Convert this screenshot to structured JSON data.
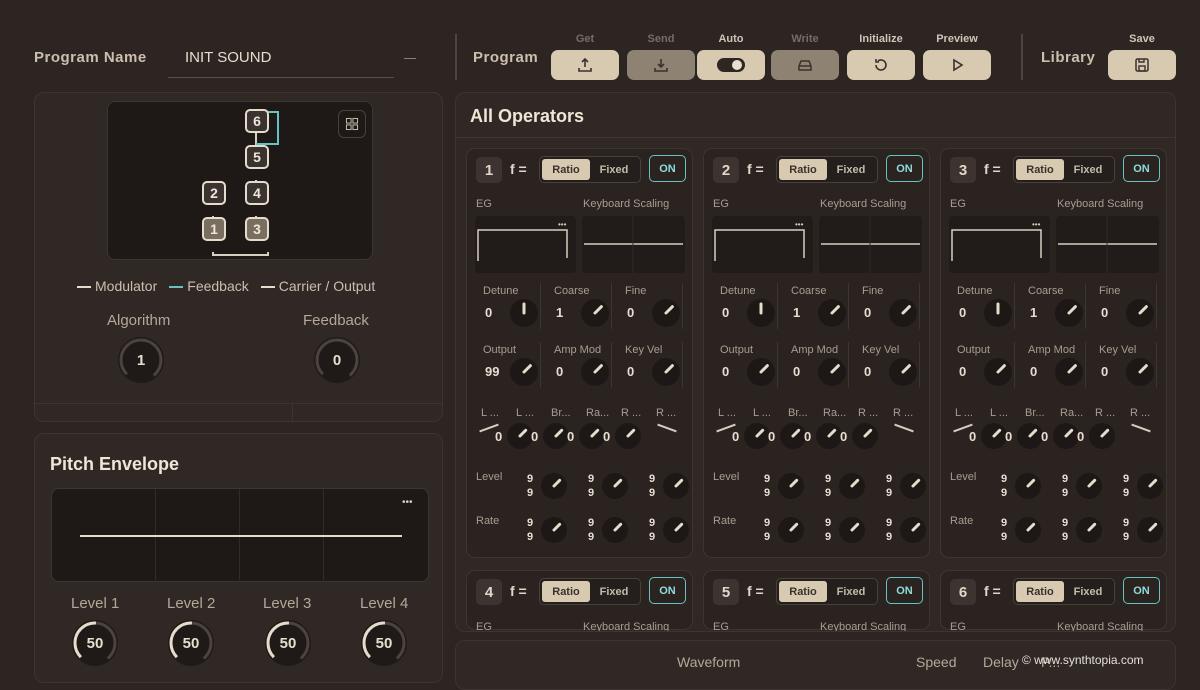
{
  "header": {
    "program_name_label": "Program Name",
    "program_name_value": "INIT SOUND",
    "program_label": "Program",
    "library_label": "Library",
    "buttons": {
      "get": "Get",
      "send": "Send",
      "auto": "Auto",
      "write": "Write",
      "initialize": "Initialize",
      "preview": "Preview",
      "save": "Save"
    }
  },
  "algorithm": {
    "legend_modulator": "Modulator",
    "legend_feedback": "Feedback",
    "legend_carrier": "Carrier / Output",
    "algorithm_label": "Algorithm",
    "algorithm_value": "1",
    "feedback_label": "Feedback",
    "feedback_value": "0",
    "nodes": [
      "6",
      "5",
      "4",
      "3",
      "2",
      "1"
    ]
  },
  "pitch_envelope": {
    "title": "Pitch Envelope",
    "more": "•••",
    "levels": [
      {
        "label": "Level 1",
        "value": "50"
      },
      {
        "label": "Level 2",
        "value": "50"
      },
      {
        "label": "Level 3",
        "value": "50"
      },
      {
        "label": "Level 4",
        "value": "50"
      }
    ]
  },
  "operators_section": {
    "title": "All Operators",
    "f_label": "f =",
    "ratio": "Ratio",
    "fixed": "Fixed",
    "on": "ON",
    "eg": "EG",
    "keyboard_scaling": "Keyboard Scaling",
    "more": "•••",
    "detune": "Detune",
    "coarse": "Coarse",
    "fine": "Fine",
    "output": "Output",
    "amp_mod": "Amp Mod",
    "key_vel": "Key Vel",
    "ks_labels": [
      "L ...",
      "L ...",
      "Br...",
      "Ra...",
      "R ...",
      "R ..."
    ],
    "level": "Level",
    "rate": "Rate",
    "nine": "9",
    "operators": [
      {
        "num": "1",
        "detune": "0",
        "coarse": "1",
        "fine": "0",
        "output": "99",
        "amp_mod": "0",
        "key_vel": "0",
        "ks": [
          "0",
          "0",
          "0",
          "0"
        ]
      },
      {
        "num": "2",
        "detune": "0",
        "coarse": "1",
        "fine": "0",
        "output": "0",
        "amp_mod": "0",
        "key_vel": "0",
        "ks": [
          "0",
          "0",
          "0",
          "0"
        ]
      },
      {
        "num": "3",
        "detune": "0",
        "coarse": "1",
        "fine": "0",
        "output": "0",
        "amp_mod": "0",
        "key_vel": "0",
        "ks": [
          "0",
          "0",
          "0",
          "0"
        ]
      }
    ],
    "lower_ops": [
      "4",
      "5",
      "6"
    ]
  },
  "lfo": {
    "waveform": "Waveform",
    "speed": "Speed",
    "delay": "Delay",
    "pmd": "P...",
    "more_cut": "A..."
  },
  "watermark": "© www.synthtopia.com",
  "colors": {
    "accent": "#d8c9b1",
    "feedback": "#66c3c4",
    "background": "#2c2522"
  }
}
